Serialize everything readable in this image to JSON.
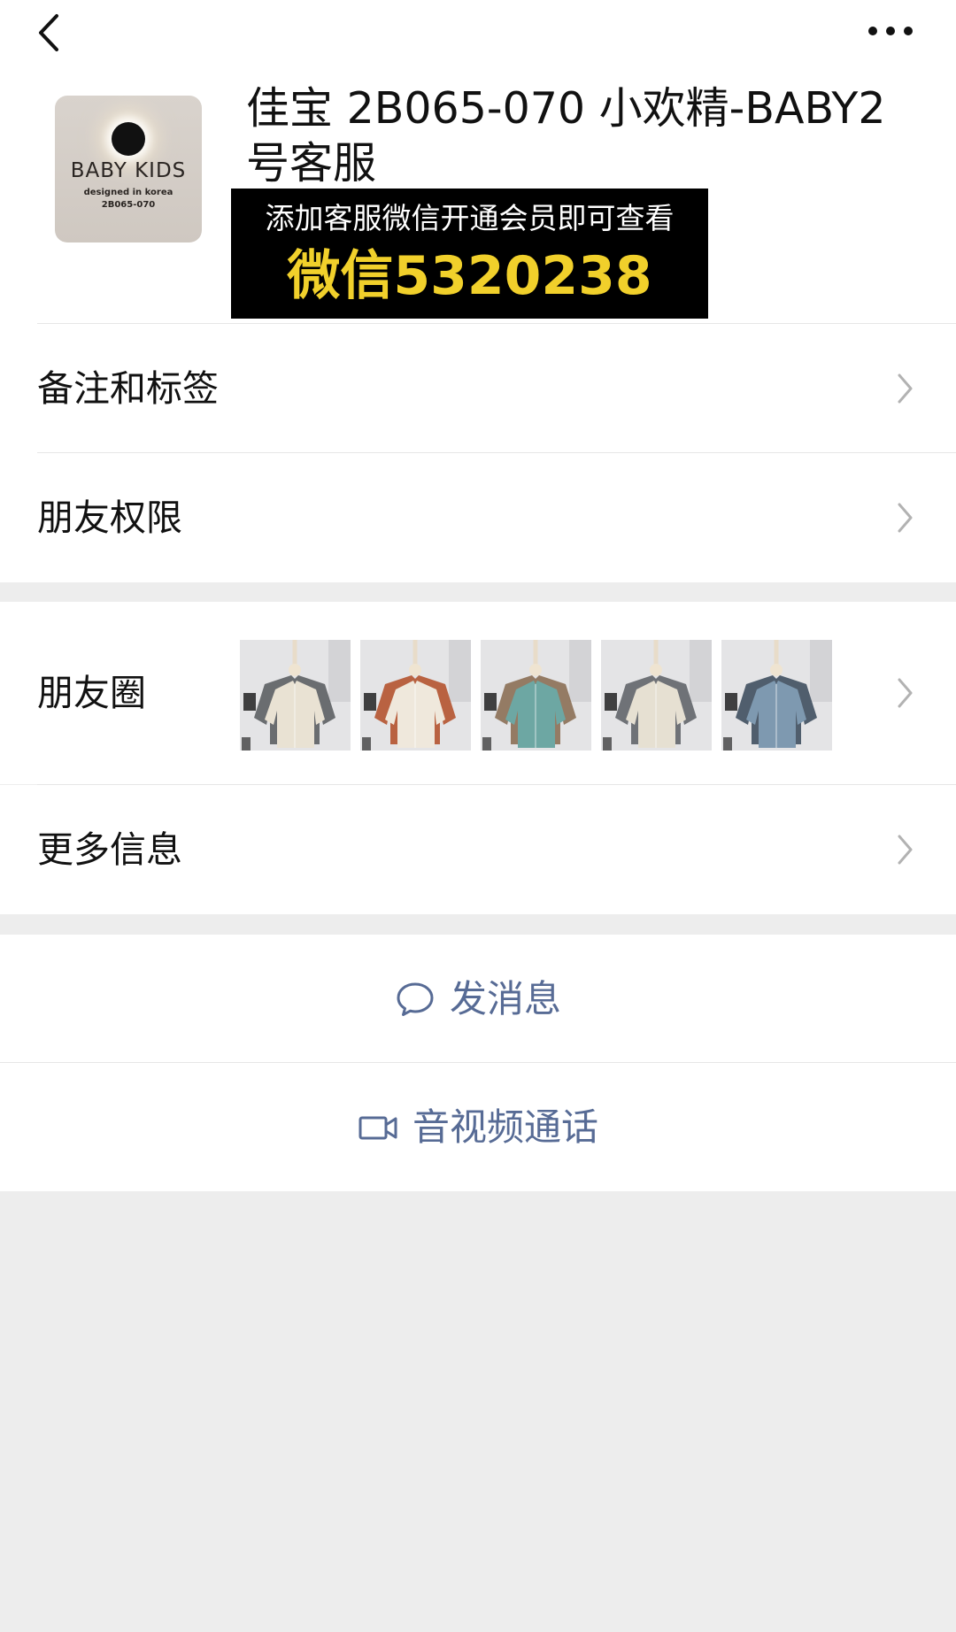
{
  "nav": {
    "back_icon": "chevron-left-icon",
    "more_icon": "more-dots-icon"
  },
  "profile": {
    "name": "佳宝 2B065-070 小欢精-BABY2号客服",
    "avatar": {
      "brand": "BABY KIDS",
      "tagline": "designed in korea",
      "code": "2B065-070"
    }
  },
  "promo": {
    "line1": "添加客服微信开通会员即可查看",
    "line2": "微信5320238",
    "colors": {
      "background": "#000000",
      "line1": "#ffffff",
      "line2": "#f1d02b"
    }
  },
  "menu": {
    "notes_tags": "备注和标签",
    "friend_permissions": "朋友权限",
    "moments": "朋友圈",
    "more_info": "更多信息"
  },
  "moments_thumbnails": [
    {
      "name": "moments-photo-1",
      "primary": "#e9e2d3",
      "secondary": "#5c5f63"
    },
    {
      "name": "moments-photo-2",
      "primary": "#efe8dc",
      "secondary": "#b4532f"
    },
    {
      "name": "moments-photo-3",
      "primary": "#6da7a3",
      "secondary": "#8b6f55"
    },
    {
      "name": "moments-photo-4",
      "primary": "#e6e0d2",
      "secondary": "#62656a"
    },
    {
      "name": "moments-photo-5",
      "primary": "#7e99b0",
      "secondary": "#3f4f5f"
    }
  ],
  "actions": {
    "message": "发消息",
    "message_icon": "chat-bubble-icon",
    "call": "音视频通话",
    "call_icon": "video-camera-icon"
  },
  "colors": {
    "page_background": "#ededed",
    "panel_background": "#ffffff",
    "link_blue": "#576b95",
    "chevron": "#b2b2b2"
  }
}
